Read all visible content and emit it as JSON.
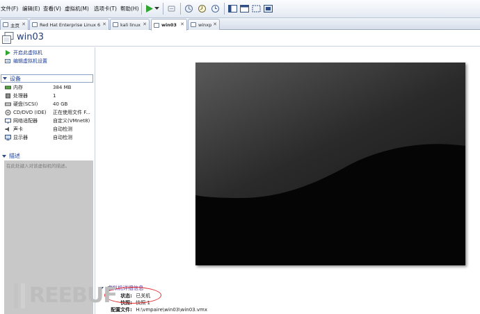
{
  "menu": {
    "items": [
      "文件(F)",
      "编辑(E)",
      "查看(V)",
      "虚拟机(M)",
      "选项卡(T)",
      "帮助(H)"
    ]
  },
  "toolbar": {
    "icons": [
      "power-on-icon",
      "dropdown-arrow-icon",
      "send-ctrl-alt-del-icon",
      "snapshot-take-icon",
      "snapshot-revert-icon",
      "snapshot-manager-icon",
      "view-normal-icon",
      "view-console-icon",
      "view-fullscreen-icon",
      "view-unity-icon"
    ],
    "accent": "#2fa52f"
  },
  "tabs": [
    {
      "label": "主页",
      "active": false
    },
    {
      "label": "Red Hat Enterprise Linux 6",
      "active": false
    },
    {
      "label": "kali linux",
      "active": false
    },
    {
      "label": "win03",
      "active": true
    },
    {
      "label": "winxp",
      "active": false
    }
  ],
  "vm": {
    "title": "win03"
  },
  "commands": [
    {
      "label": "开启此虚拟机",
      "icon": "play-icon"
    },
    {
      "label": "编辑虚拟机设置",
      "icon": "settings-icon"
    }
  ],
  "devices": {
    "heading": "设备",
    "rows": [
      {
        "name": "内存",
        "value": "384 MB",
        "icon": "memory-icon"
      },
      {
        "name": "处理器",
        "value": "1",
        "icon": "cpu-icon"
      },
      {
        "name": "硬盘(SCSI)",
        "value": "40 GB",
        "icon": "harddisk-icon"
      },
      {
        "name": "CD/DVD (IDE)",
        "value": "正在使用文件 F...",
        "icon": "cdrom-icon"
      },
      {
        "name": "网络适配器",
        "value": "自定义(VMnet8)",
        "icon": "network-icon"
      },
      {
        "name": "声卡",
        "value": "自动检测",
        "icon": "sound-icon"
      },
      {
        "name": "显示器",
        "value": "自动检测",
        "icon": "display-icon"
      }
    ]
  },
  "description": {
    "heading": "描述",
    "placeholder": "在此处键入对该虚拟机的描述。"
  },
  "details": {
    "heading": "虚拟机详细信息",
    "rows": [
      {
        "key": "状态:",
        "value": "已关机"
      },
      {
        "key": "快照:",
        "value": "快照 1"
      },
      {
        "key": "配置文件:",
        "value": "H:\\vmpaire\\win03\\win03.vmx"
      }
    ]
  },
  "watermark": {
    "text": "REEBUF"
  },
  "colors": {
    "link": "#1b3d97",
    "annotation": "#e23131",
    "preview_bg": "#050505",
    "description_bg": "#c8c8c8"
  }
}
